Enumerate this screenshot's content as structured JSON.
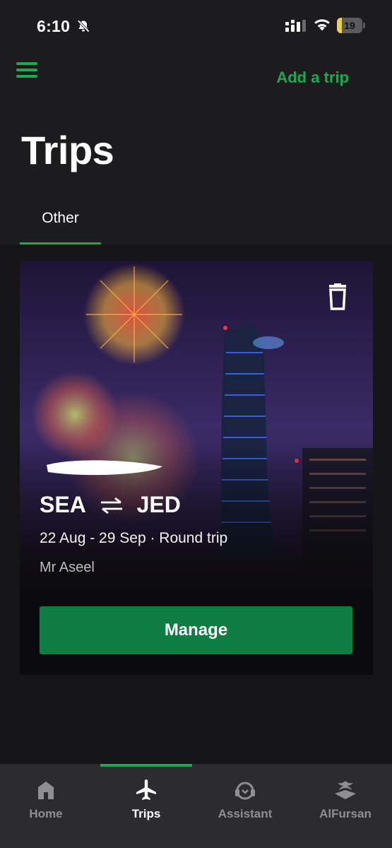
{
  "status_bar": {
    "time": "6:10",
    "battery_level": "19",
    "battery_fraction": 0.19
  },
  "header": {
    "menu_icon": "hamburger-menu-icon",
    "add_trip_label": "Add a trip",
    "title": "Trips"
  },
  "tabs": [
    {
      "label": "Other",
      "active": true
    }
  ],
  "trip": {
    "origin": "SEA",
    "destination": "JED",
    "dates": "22 Aug - 29 Sep · Round trip",
    "passenger": "Mr Aseel",
    "manage_label": "Manage",
    "delete_icon": "trash-icon"
  },
  "bottom_nav": [
    {
      "label": "Home",
      "icon": "home-icon",
      "active": false
    },
    {
      "label": "Trips",
      "icon": "airplane-icon",
      "active": true
    },
    {
      "label": "Assistant",
      "icon": "headset-icon",
      "active": false
    },
    {
      "label": "AlFursan",
      "icon": "alfursan-logo-icon",
      "active": false
    }
  ],
  "colors": {
    "accent": "#1da851",
    "button": "#0e7d43",
    "background": "#1c1c1e",
    "nav_background": "#2c2c2e"
  }
}
